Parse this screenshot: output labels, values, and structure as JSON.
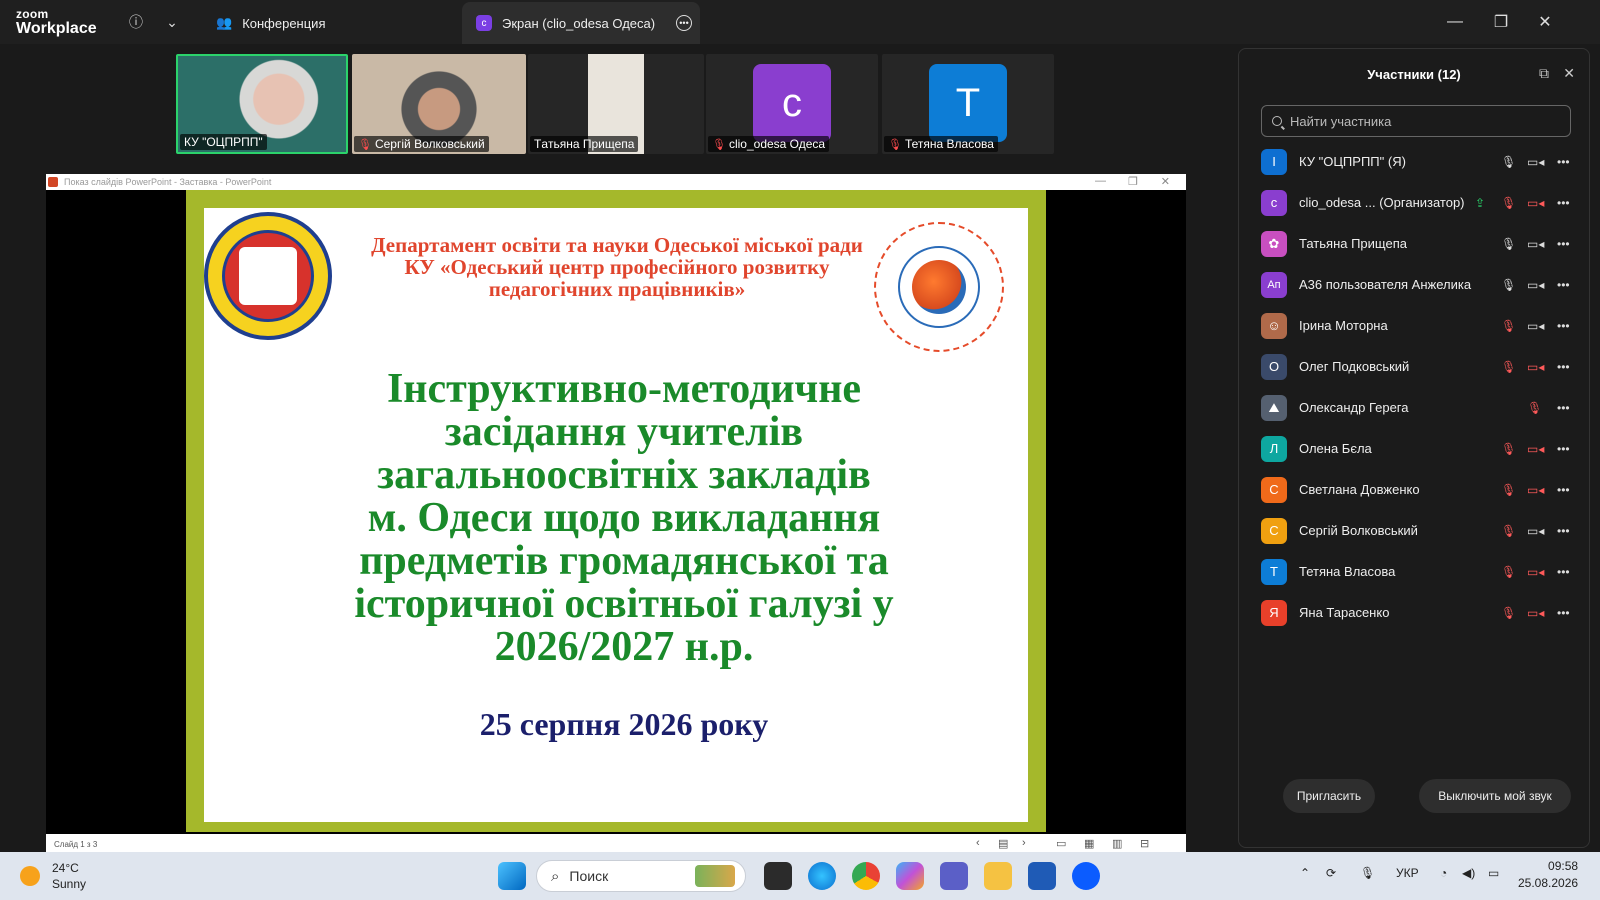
{
  "app": {
    "logo_line1": "zoom",
    "logo_line2": "Workplace",
    "tabs": [
      {
        "label": "Конференция"
      },
      {
        "label": "Экран (clio_odesa Одеса)",
        "badge": "c"
      }
    ]
  },
  "video_strip": [
    {
      "name": "КУ \"ОЦПРПП\"",
      "active": true,
      "muted": false
    },
    {
      "name": "Сергій Волковський",
      "muted": true
    },
    {
      "name": "Тaтьяна Прищепа",
      "muted": false
    },
    {
      "name": "clio_odesa Одеса",
      "muted": true,
      "avatar_letter": "c",
      "avatar_color": "#8a3ecf"
    },
    {
      "name": "Тетяна Власова",
      "muted": true,
      "avatar_letter": "T",
      "avatar_color": "#0d7dd6"
    }
  ],
  "powerpoint": {
    "titlebar": "Показ слайдів PowerPoint  -  Заставка  -  PowerPoint",
    "status": "Слайд 1 з 3"
  },
  "slide": {
    "org_line1": "Департамент освіти та науки Одеської міської ради",
    "org_line2": "КУ «Одеський центр професійного розвитку",
    "org_line3": "педагогічних працівників»",
    "title_lines": [
      "Інструктивно-методичне",
      "засідання учителів",
      "загальноосвітніх закладів",
      "м. Одеси щодо викладання",
      "предметів громадянської та",
      "історичної освітньої галузі у",
      "2026/2027 н.р."
    ],
    "date": "25 серпня 2026 року"
  },
  "participants_panel": {
    "title": "Участники (12)",
    "search_placeholder": "Найти участника",
    "participants": [
      {
        "name": "КУ \"ОЦПРПП\" (Я)",
        "initial": "І",
        "color": "#0e6fd1",
        "mic": "on",
        "cam": "on"
      },
      {
        "name": "clio_odesa ...  (Организатор)",
        "initial": "c",
        "color": "#8a3ecf",
        "mic": "off",
        "cam": "off",
        "sharing": true
      },
      {
        "name": "Татьяна Прищепа",
        "initial": "✿",
        "color": "#c84fc0",
        "mic": "on",
        "cam": "on"
      },
      {
        "name": "А36 пользователя Анжелика",
        "initial": "Ап",
        "color": "#8a3ecf",
        "mic": "on",
        "cam": "on"
      },
      {
        "name": "Ірина Моторна",
        "initial": "☺",
        "color": "#b06a4a",
        "mic": "off",
        "cam": "on"
      },
      {
        "name": "Олег Подковський",
        "initial": "О",
        "color": "#3a4a6a",
        "mic": "off",
        "cam": "off"
      },
      {
        "name": "Олександр Герега",
        "initial": "⛰",
        "color": "#556070",
        "mic": "off",
        "cam": "none"
      },
      {
        "name": "Олена Бєла",
        "initial": "Л",
        "color": "#0ea7a0",
        "mic": "off",
        "cam": "off"
      },
      {
        "name": "Светлана Довженко",
        "initial": "С",
        "color": "#f06a1a",
        "mic": "off",
        "cam": "off"
      },
      {
        "name": "Сергій Волковський",
        "initial": "С",
        "color": "#f0a010",
        "mic": "off",
        "cam": "on"
      },
      {
        "name": "Тетяна Власова",
        "initial": "Т",
        "color": "#0d7dd6",
        "mic": "off",
        "cam": "off"
      },
      {
        "name": "Яна Тарасенко",
        "initial": "Я",
        "color": "#e8402a",
        "mic": "off",
        "cam": "off"
      }
    ],
    "invite_label": "Пригласить",
    "mute_me_label": "Выключить мой звук"
  },
  "taskbar": {
    "temperature": "24°C",
    "weather": "Sunny",
    "search_label": "Поиск",
    "language": "УКР",
    "time": "09:58",
    "date": "25.08.2026"
  }
}
